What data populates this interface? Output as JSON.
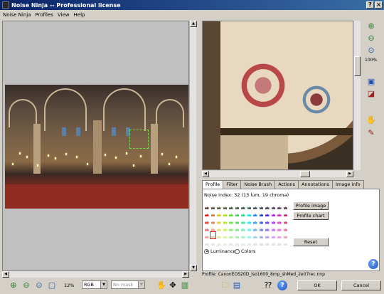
{
  "window": {
    "title": "Noise Ninja -- Professional license"
  },
  "menu": [
    "Noise Ninja",
    "Profiles",
    "View",
    "Help"
  ],
  "toolbar_right": {
    "zoom_percent": "100%"
  },
  "tabs": [
    "Profile",
    "Filter",
    "Noise Brush",
    "Actions",
    "Annotations",
    "Image info"
  ],
  "profile_panel": {
    "noise_index": "Noise index: 32 (13 lum, 19 chroma)",
    "profile_image": "Profile image",
    "profile_chart": "Profile chart",
    "reset": "Reset",
    "luminance": "Luminance",
    "colors": "Colors",
    "selected_mode": "luminance"
  },
  "profile_line": "Profile: CanonEOS20D_iso1600_8mp_shMed_2e07rec.nnp",
  "bottom": {
    "zoom_level": "12%",
    "color_space": "RGB",
    "mask": "No mask",
    "ok": "OK",
    "cancel": "Cancel"
  },
  "colors": {
    "accent": "#0a246a",
    "selection": "#6fdc4a"
  }
}
